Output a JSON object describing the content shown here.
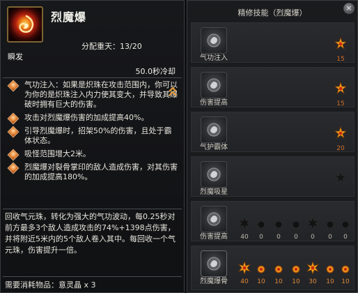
{
  "tooltip": {
    "title": "烈魔爆",
    "points_label": "分配重天：13/20",
    "skill_type": "瞬发",
    "cooldown": "50.0秒冷却",
    "effects": [
      "气功注入：如果是炽珠在攻击范围内，你可以为你的是炽珠注入内力使其变大，并导致其爆破时拥有巨大的伤害。",
      "攻击对烈魔爆伤害的加成提高40%。",
      "引导烈魔爆时，招架50%的伤害，且处于霸体状态。",
      "吸怪范围增大2米。",
      "烈魔爆对裂骨掌印的敌人造成伤害，对其伤害的加成提高180%。"
    ],
    "description": "回收气元珠，转化为强大的气功波动，每0.25秒对前方最多3个敌人造成攻击的74%+1398点伤害，并将附近5米内的5个敌人卷入其中。每回收一个气元珠，伤害提升一倍。",
    "consume": "需要消耗物品：意灵晶 x 3"
  },
  "mastery": {
    "title": "精修技能（烈魔爆）",
    "close_label": "×",
    "nodes": [
      {
        "label": "气功注入",
        "req": "15",
        "icon": "fist-icon"
      },
      {
        "label": "伤害提高",
        "req": "15",
        "icon": "fist-icon"
      },
      {
        "label": "气护霸体",
        "req": "20",
        "icon": "fist-icon"
      },
      {
        "label": "烈魔吸星",
        "req": "",
        "icon": "fist-icon"
      },
      {
        "label": "伤害提高",
        "req": "",
        "icon": "fist-icon",
        "steps": [
          "40",
          "0",
          "0",
          "0",
          "0",
          "0",
          "0"
        ]
      },
      {
        "label": "烈魔爆骨",
        "req": "",
        "icon": "fist-icon",
        "steps": [
          "40",
          "10",
          "10",
          "10",
          "30",
          "10",
          "10"
        ]
      }
    ]
  },
  "colors": {
    "accent": "#e07a2c",
    "star": "#f0a020",
    "panel": "#1a1b1d"
  }
}
